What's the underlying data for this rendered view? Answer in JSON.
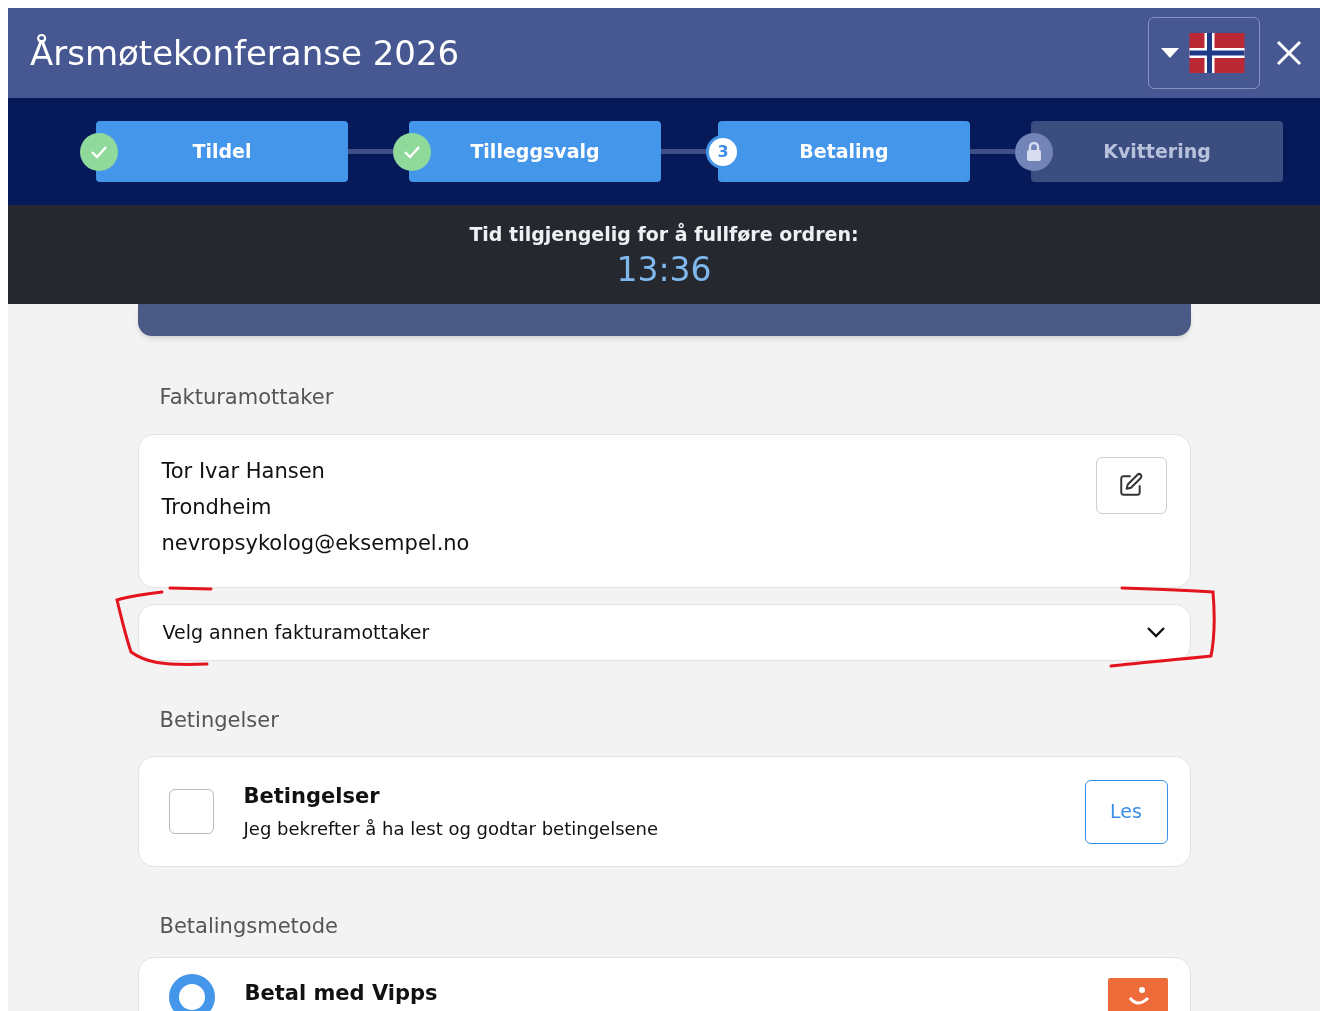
{
  "header": {
    "title": "Årsmøtekonferanse 2026"
  },
  "steps": [
    {
      "label": "Tildel",
      "done": true,
      "selected": false,
      "locked": false
    },
    {
      "label": "Tilleggsvalg",
      "done": true,
      "selected": false,
      "locked": false
    },
    {
      "label": "Betaling",
      "done": false,
      "selected": true,
      "locked": false,
      "number": "3"
    },
    {
      "label": "Kvittering",
      "done": false,
      "selected": false,
      "locked": true
    }
  ],
  "timer": {
    "label": "Tid tilgjengelig for å fullføre ordren:",
    "value": "13:36"
  },
  "invoice": {
    "heading": "Fakturamottaker",
    "lines": [
      "Tor Ivar Hansen",
      "Trondheim",
      "nevropsykolog@eksempel.no"
    ],
    "select_label": "Velg annen fakturamottaker"
  },
  "terms": {
    "heading": "Betingelser",
    "title": "Betingelser",
    "text": "Jeg bekrefter å ha lest og godtar betingelsene",
    "checked": false,
    "button": "Les"
  },
  "payment": {
    "heading": "Betalingsmetode",
    "methods": [
      {
        "label": "Betal med Vipps",
        "selected": true
      }
    ]
  }
}
